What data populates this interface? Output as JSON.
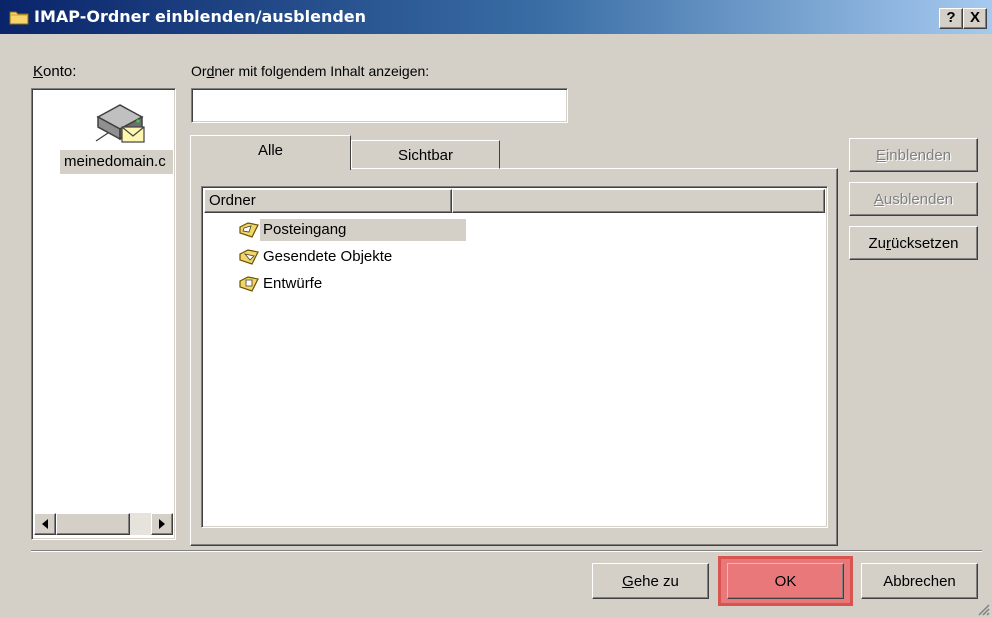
{
  "window": {
    "title": "IMAP-Ordner einblenden/ausblenden",
    "help_button": "?",
    "close_button": "X"
  },
  "account": {
    "label": "Konto:",
    "label_underline": "K",
    "label_rest": "onto:",
    "items": [
      {
        "name": "meinedomain.c"
      }
    ]
  },
  "filter": {
    "label_pre": "Or",
    "label_underline": "d",
    "label_post": "ner mit folgendem Inhalt anzeigen:",
    "value": ""
  },
  "tabs": [
    {
      "label": "Alle",
      "active": true
    },
    {
      "label": "Sichtbar",
      "active": false
    }
  ],
  "folder_list": {
    "columns": [
      "Ordner",
      ""
    ],
    "rows": [
      {
        "name": "Posteingang",
        "selected": true,
        "icon": "inbox-folder-icon"
      },
      {
        "name": "Gesendete Objekte",
        "selected": false,
        "icon": "sent-folder-icon"
      },
      {
        "name": "Entwürfe",
        "selected": false,
        "icon": "drafts-folder-icon"
      }
    ]
  },
  "side_buttons": {
    "show": {
      "u": "E",
      "rest": "inblenden",
      "enabled": false
    },
    "hide": {
      "u": "A",
      "rest": "usblenden",
      "enabled": false
    },
    "reset": {
      "pre": "Zu",
      "u": "r",
      "rest": "ücksetzen",
      "enabled": true
    }
  },
  "footer": {
    "goto": {
      "u": "G",
      "rest": "ehe zu"
    },
    "ok": "OK",
    "cancel": "Abbrechen"
  },
  "colors": {
    "selection": "#d4d0c8",
    "ok_highlight": "#e8787a",
    "ok_border": "#d9534f"
  }
}
